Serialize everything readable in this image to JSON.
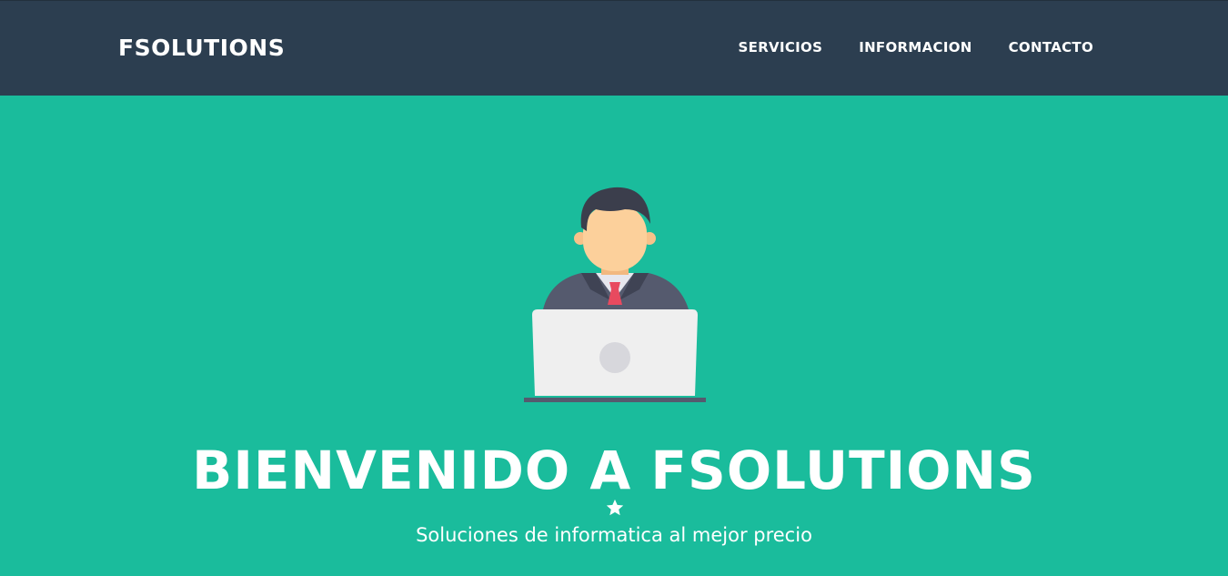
{
  "navbar": {
    "brand": "FSOLUTIONS",
    "links": [
      {
        "label": "SERVICIOS"
      },
      {
        "label": "INFORMACION"
      },
      {
        "label": "CONTACTO"
      }
    ]
  },
  "masthead": {
    "avatar_icon": "businessman-at-laptop-icon",
    "title": "BIENVENIDO A FSOLUTIONS",
    "divider_icon": "star-icon",
    "subtitle": "Soluciones de informatica al mejor precio"
  },
  "colors": {
    "navbar_bg": "#2c3e50",
    "masthead_bg": "#1abc9c",
    "text": "#ffffff"
  }
}
